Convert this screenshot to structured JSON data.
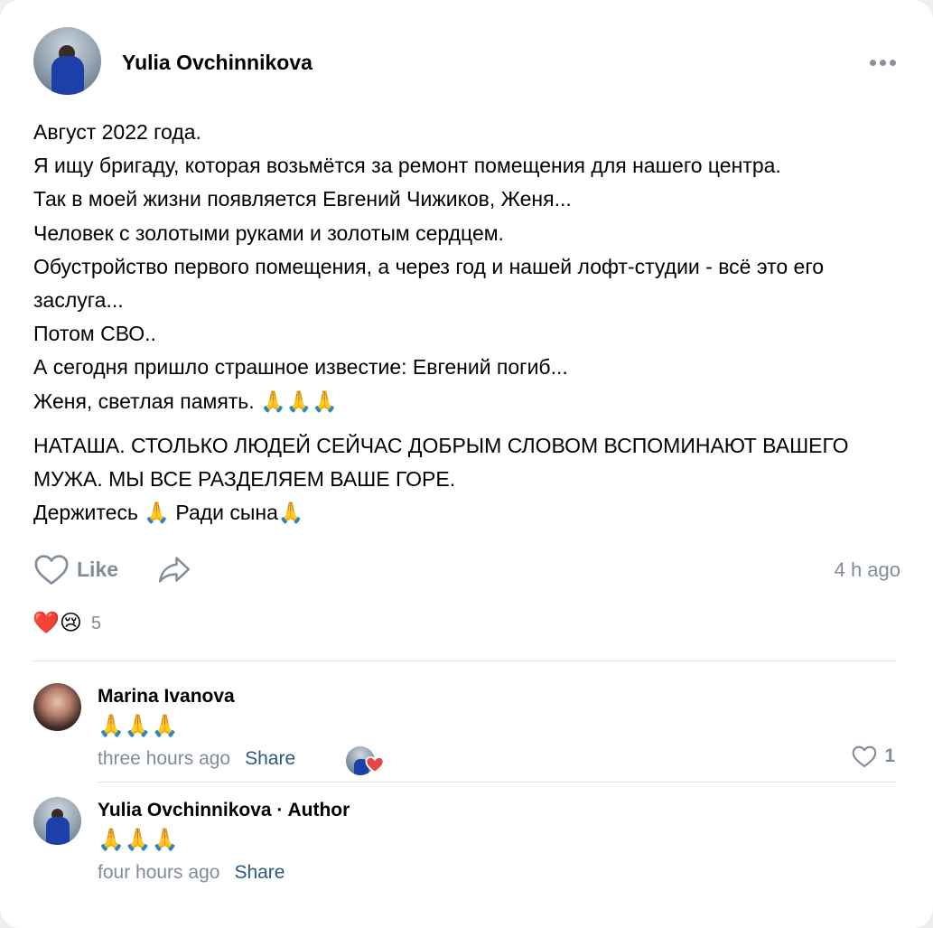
{
  "post": {
    "author": "Yulia Ovchinnikova",
    "lines1": [
      "Август 2022 года.",
      "Я ищу бригаду, которая возьмётся за ремонт помещения для нашего центра.",
      "Так в моей жизни появляется Евгений Чижиков, Женя...",
      "Человек с золотыми руками и золотым сердцем.",
      "Обустройство первого помещения, а через год и нашей лофт-студии - всё это его заслуга...",
      "Потом СВО..",
      "А сегодня пришло страшное известие: Евгений погиб...",
      "Женя, светлая память. 🙏🙏🙏"
    ],
    "lines2": [
      "НАТАША. СТОЛЬКО ЛЮДЕЙ СЕЙЧАС ДОБРЫМ СЛОВОМ ВСПОМИНАЮТ ВАШЕГО МУЖА. МЫ ВСЕ РАЗДЕЛЯЕМ ВАШЕ ГОРЕ.",
      "Держитесь 🙏 Ради сына🙏"
    ],
    "like_label": "Like",
    "time": "4 h ago",
    "reactions": "❤️😢",
    "reaction_count": "5"
  },
  "comments": [
    {
      "name": "Marina Ivanova",
      "text": "🙏🙏🙏",
      "time": "three hours ago",
      "share": "Share",
      "likes": "1"
    },
    {
      "name": "Yulia Ovchinnikova · Author",
      "text": "🙏🙏🙏",
      "time": "four hours ago",
      "share": "Share"
    }
  ],
  "icons": {
    "more": "more-dots-icon",
    "like": "heart-outline-icon",
    "share": "share-arrow-icon",
    "liked": "heart-filled-icon"
  },
  "colors": {
    "link": "#2a5885",
    "muted": "#818c99",
    "heart": "#e64646"
  }
}
